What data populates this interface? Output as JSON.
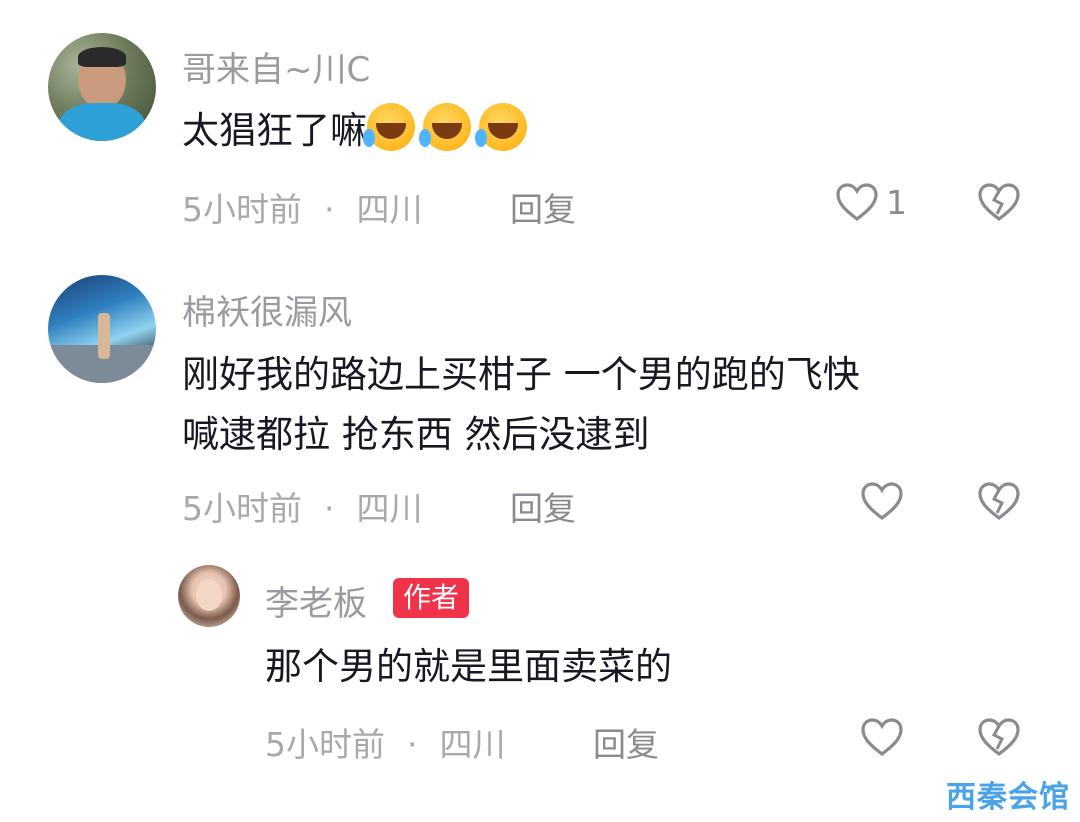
{
  "comments": [
    {
      "username": "哥来自~川C",
      "text": "太猖狂了嘛",
      "emoji_count": 3,
      "time": "5小时前",
      "location": "四川",
      "reply_label": "回复",
      "like_count": "1"
    },
    {
      "username": "棉袄很漏风",
      "text_line1": "刚好我的路边上买柑子 一个男的跑的飞快",
      "text_line2": "喊逮都拉 抢东西  然后没逮到",
      "time": "5小时前",
      "location": "四川",
      "reply_label": "回复"
    }
  ],
  "reply": {
    "username": "李老板",
    "badge": "作者",
    "text": "那个男的就是里面卖菜的",
    "time": "5小时前",
    "location": "四川",
    "reply_label": "回复"
  },
  "separator": "·",
  "watermark": "西秦会馆",
  "icons": {
    "like": "heart-outline-icon",
    "dislike": "broken-heart-icon",
    "emoji": "laughing-crying-emoji"
  },
  "colors": {
    "author_badge": "#f1334a",
    "meta_text": "#a8a8ad",
    "body_text": "#161823"
  }
}
